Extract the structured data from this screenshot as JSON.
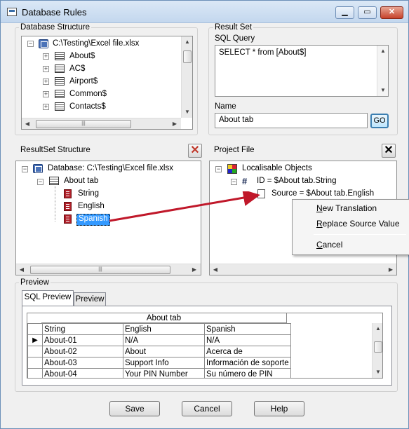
{
  "window": {
    "title": "Database Rules"
  },
  "db_structure": {
    "label": "Database Structure",
    "root": "C:\\Testing\\Excel file.xlsx",
    "tables": [
      "About$",
      "AC$",
      "Airport$",
      "Common$",
      "Contacts$"
    ]
  },
  "result_set": {
    "label": "Result Set",
    "sql_label": "SQL Query",
    "sql_value": "SELECT * from [About$]",
    "name_label": "Name",
    "name_value": "About tab",
    "go_label": "GO"
  },
  "resultset_structure": {
    "label": "ResultSet Structure",
    "root": "Database: C:\\Testing\\Excel file.xlsx",
    "table": "About tab",
    "columns": [
      "String",
      "English",
      "Spanish"
    ],
    "selected": "Spanish"
  },
  "project_file": {
    "label": "Project File",
    "root": "Localisable Objects",
    "id_row": "ID = $About tab.String",
    "source_row": "Source = $About tab.English"
  },
  "context_menu": {
    "items": [
      {
        "accel": "N",
        "rest": "ew Translation"
      },
      {
        "accel": "R",
        "rest": "eplace Source Value"
      },
      {
        "accel": "C",
        "rest": "ancel"
      }
    ]
  },
  "preview": {
    "label": "Preview",
    "tabs": [
      "SQL Preview",
      "Preview"
    ],
    "table_caption": "About tab",
    "headers": [
      "String",
      "English",
      "Spanish"
    ],
    "rows": [
      [
        "About-01",
        "N/A",
        "N/A"
      ],
      [
        "About-02",
        "About",
        "Acerca de"
      ],
      [
        "About-03",
        "Support Info",
        "Información de soporte"
      ],
      [
        "About-04",
        "Your PIN Number",
        "Su número de PIN"
      ]
    ]
  },
  "buttons": {
    "save": "Save",
    "cancel": "Cancel",
    "help": "Help"
  },
  "colors": {
    "selection": "#3399ff",
    "arrow": "#c0182a",
    "go_border": "#3c7fb1"
  }
}
